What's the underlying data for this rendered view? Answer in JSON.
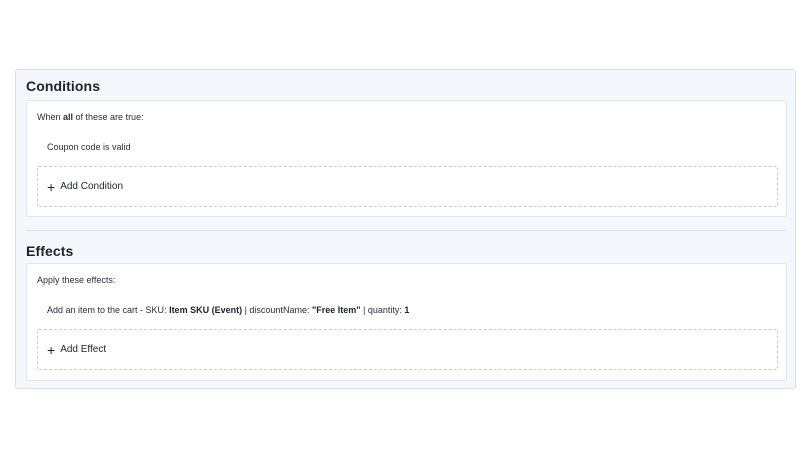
{
  "conditions": {
    "title": "Conditions",
    "intro_prefix": "When ",
    "intro_keyword": "all",
    "intro_suffix": " of these are true:",
    "items": [
      "Coupon code is valid"
    ],
    "add_label": "Add Condition"
  },
  "effects": {
    "title": "Effects",
    "intro": "Apply these effects:",
    "item": {
      "text1": "Add an item to the cart - SKU: ",
      "sku": "Item SKU (Event)",
      "text2": " | discountName: ",
      "discount_name": "\"Free Item\"",
      "text3": " | quantity: ",
      "quantity": "1"
    },
    "add_label": "Add Effect"
  },
  "icons": {
    "add": "plus-icon"
  }
}
